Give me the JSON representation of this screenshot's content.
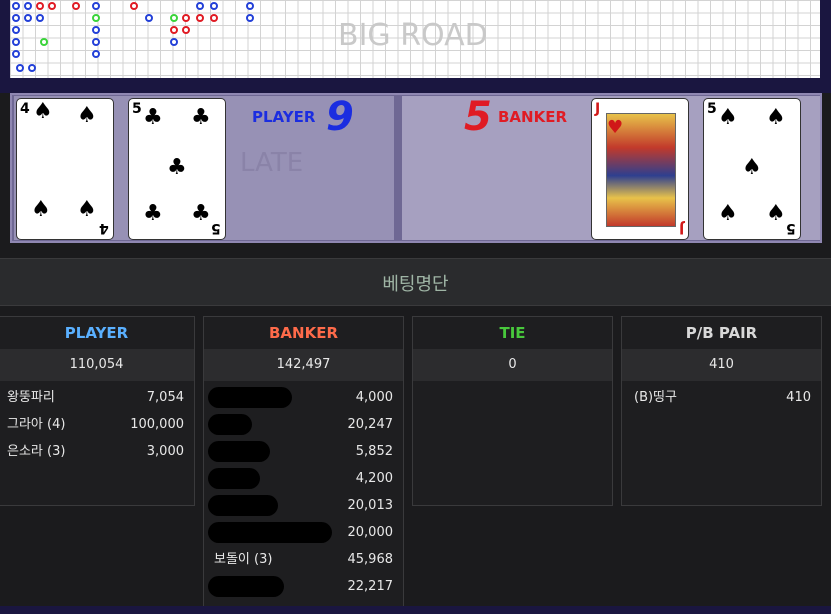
{
  "big_road": {
    "title": "BIG ROAD"
  },
  "bead_ghost_text": "LATE",
  "player": {
    "label": "PLAYER",
    "score": "9",
    "cards": [
      {
        "rank": "4",
        "suit": "♠",
        "color": "black"
      },
      {
        "rank": "5",
        "suit": "♣",
        "color": "black"
      }
    ]
  },
  "banker": {
    "label": "BANKER",
    "score": "5",
    "cards": [
      {
        "rank": "J",
        "suit": "♥",
        "color": "red"
      },
      {
        "rank": "5",
        "suit": "♠",
        "color": "black"
      }
    ]
  },
  "betting": {
    "title": "베팅명단",
    "columns": [
      {
        "label": "PLAYER",
        "color": "#5ab0ff",
        "total": "110,054",
        "rows": [
          {
            "name": "왕뚱파리",
            "amount": "7,054"
          },
          {
            "name": "그라아 (4)",
            "amount": "100,000"
          },
          {
            "name": "은소라 (3)",
            "amount": "3,000"
          }
        ]
      },
      {
        "label": "BANKER",
        "color": "#ff6b4a",
        "total": "142,497",
        "rows": [
          {
            "name": "",
            "amount": "4,000"
          },
          {
            "name": "",
            "amount": "20,247"
          },
          {
            "name": "",
            "amount": "5,852"
          },
          {
            "name": "",
            "amount": "4,200"
          },
          {
            "name": "",
            "amount": "20,013"
          },
          {
            "name": "",
            "amount": "20,000"
          },
          {
            "name": "보돌이 (3)",
            "amount": "45,968"
          },
          {
            "name": "",
            "amount": "22,217"
          }
        ]
      },
      {
        "label": "TIE",
        "color": "#48c83c",
        "total": "0",
        "rows": []
      },
      {
        "label": "P/B PAIR",
        "color": "#d8d8d8",
        "total": "410",
        "rows": [
          {
            "name": "(B)띵구",
            "amount": "410"
          }
        ]
      }
    ]
  }
}
